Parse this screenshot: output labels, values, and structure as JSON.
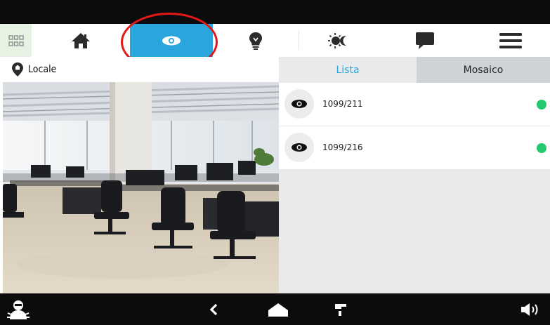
{
  "nav": {
    "items": [
      {
        "name": "grid-icon"
      },
      {
        "name": "home-icon"
      },
      {
        "name": "eye-icon",
        "active": true
      },
      {
        "name": "bulb-icon"
      },
      {
        "name": "day-night-icon"
      },
      {
        "name": "chat-icon"
      },
      {
        "name": "menu-icon"
      }
    ],
    "active_color": "#2aa6dd"
  },
  "location": {
    "label": "Locale",
    "icon": "location-pin-icon"
  },
  "tabs": {
    "lista": "Lista",
    "mosaico": "Mosaico",
    "active": "Lista"
  },
  "cameras": [
    {
      "name": "1099/211",
      "status": "online",
      "status_color": "#22c96e"
    },
    {
      "name": "1099/216",
      "status": "online",
      "status_color": "#22c96e"
    }
  ],
  "bottom_bar": {
    "items": [
      "doorbell-person-icon",
      "back-icon",
      "home-icon",
      "door-icon",
      "volume-icon"
    ]
  },
  "colors": {
    "accent": "#2aa6dd",
    "annotation": "#e51818"
  }
}
